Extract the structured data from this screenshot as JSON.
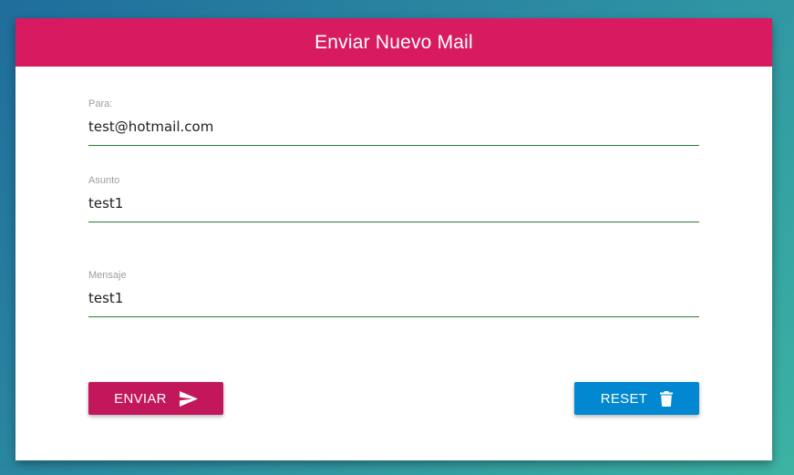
{
  "header": {
    "title": "Enviar Nuevo Mail"
  },
  "form": {
    "para": {
      "label": "Para:",
      "value": "test@hotmail.com"
    },
    "asunto": {
      "label": "Asunto",
      "value": "test1"
    },
    "mensaje": {
      "label": "Mensaje",
      "value": "test1"
    }
  },
  "buttons": {
    "send_label": "ENVIAR",
    "send_icon": "send-icon",
    "reset_label": "RESET",
    "reset_icon": "trash-icon"
  },
  "colors": {
    "header": "#d81b60",
    "send_button": "#c2185b",
    "reset_button": "#0288d1",
    "input_underline": "#2e7d32"
  }
}
